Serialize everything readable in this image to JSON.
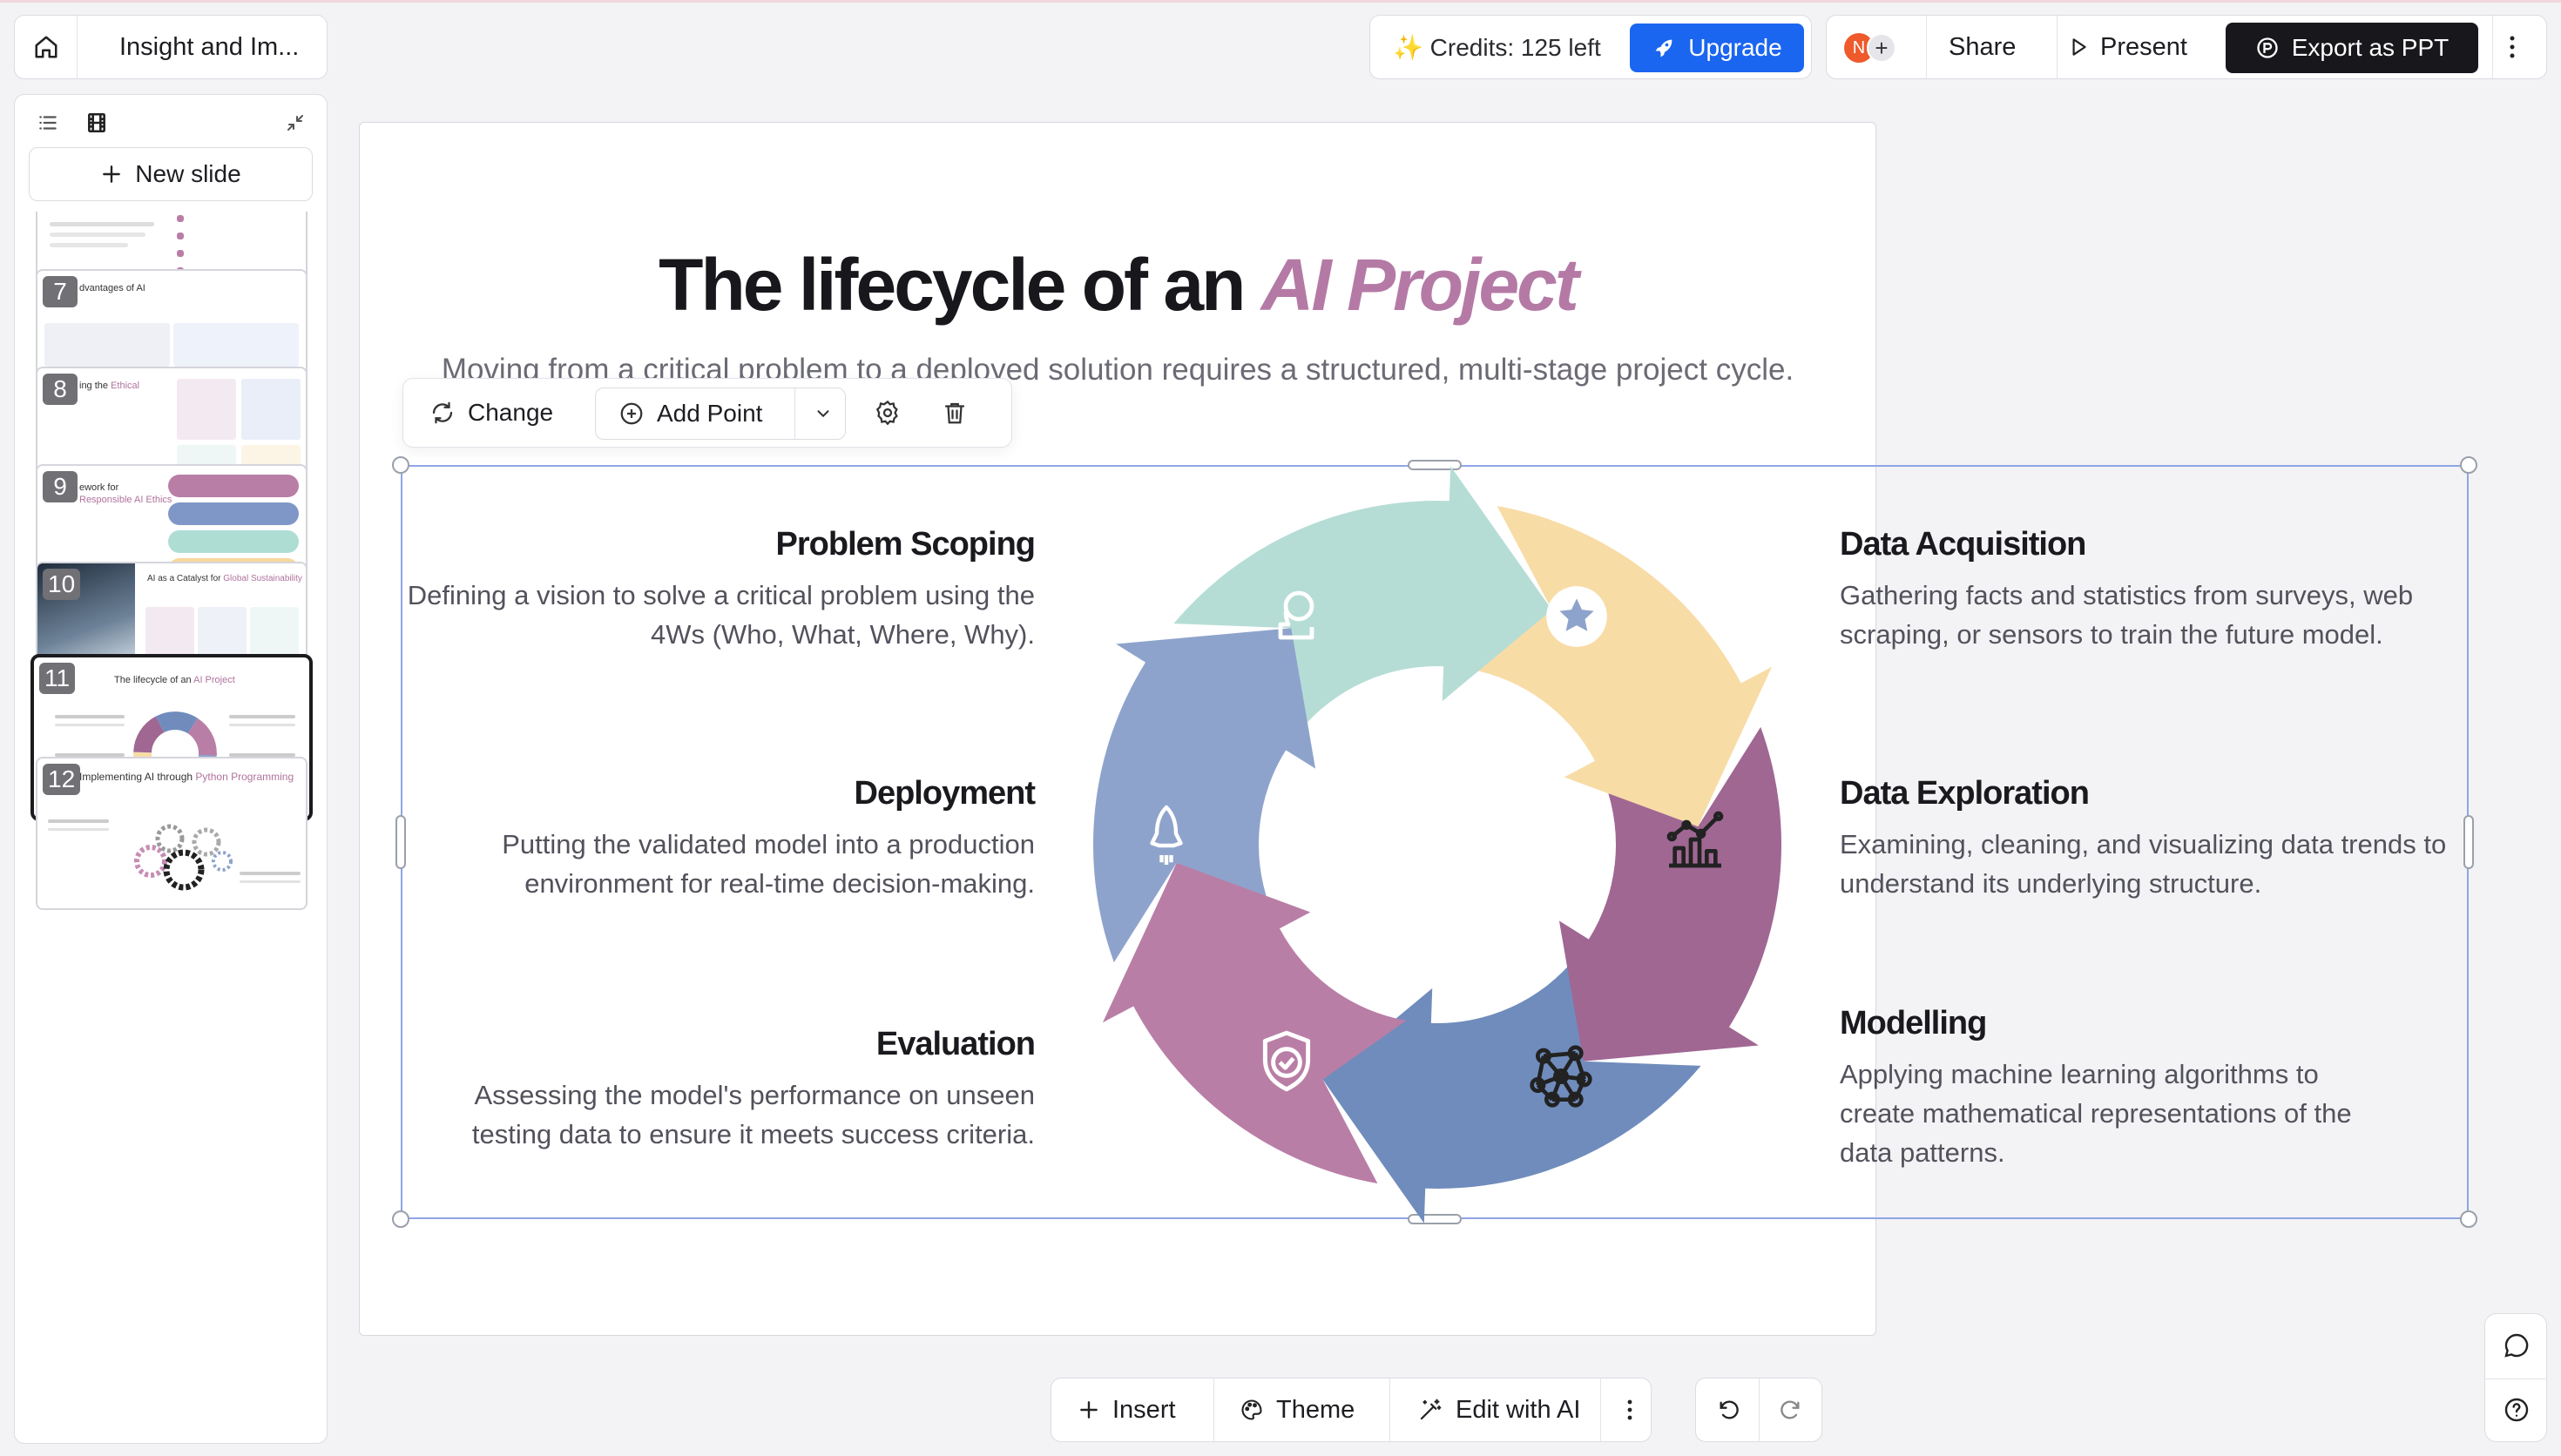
{
  "doc": {
    "title": "Insight and Im..."
  },
  "sidebar": {
    "new_slide_label": "New slide",
    "slides": [
      {
        "num": "",
        "title": "",
        "title_accent": ""
      },
      {
        "num": "7",
        "title": "dvantages of AI",
        "title_accent": ""
      },
      {
        "num": "8",
        "title": "ing the ",
        "title_accent": "Ethical"
      },
      {
        "num": "9",
        "title": "ework for",
        "title_accent": "Responsible AI Ethics"
      },
      {
        "num": "10",
        "title": "AI as a Catalyst for ",
        "title_accent": "Global Sustainability"
      },
      {
        "num": "11",
        "title": "The lifecycle of an ",
        "title_accent": "AI Project"
      },
      {
        "num": "12",
        "title": "Implementing AI through ",
        "title_accent": "Python Programming"
      }
    ]
  },
  "topbar": {
    "credits": "Credits: 125 left",
    "upgrade": "Upgrade",
    "avatar_initial": "N",
    "share": "Share",
    "present": "Present",
    "export": "Export as PPT"
  },
  "float_toolbar": {
    "change": "Change",
    "add_point": "Add Point"
  },
  "slide": {
    "title": "The lifecycle of an ",
    "title_accent": "AI Project",
    "subtitle": "Moving from a critical problem to a deployed solution requires a structured, multi-stage project cycle.",
    "points": [
      {
        "title": "Problem Scoping",
        "body": "Defining a vision to solve a critical problem using the 4Ws (Who, What, Where, Why).",
        "color": "#b97ea6"
      },
      {
        "title": "Data Acquisition",
        "body": "Gathering facts and statistics from surveys, web scraping, or sensors to train the future model.",
        "color": "#8ea3cc"
      },
      {
        "title": "Deployment",
        "body": "Putting the validated model into a production environment for real-time decision-making.",
        "color": "#6f8cbc"
      },
      {
        "title": "Data Exploration",
        "body": "Examining, cleaning, and visualizing data trends to understand its underlying structure.",
        "color": "#b5ddd5"
      },
      {
        "title": "Evaluation",
        "body": "Assessing the model's performance on unseen testing data to ensure it meets success criteria.",
        "color": "#a06793"
      },
      {
        "title": "Modelling",
        "body": "Applying machine learning algorithms to create mathematical representations of the data patterns.",
        "color": "#f8dca6"
      }
    ]
  },
  "bottom_toolbar": {
    "insert": "Insert",
    "theme": "Theme",
    "edit_ai": "Edit with AI"
  }
}
